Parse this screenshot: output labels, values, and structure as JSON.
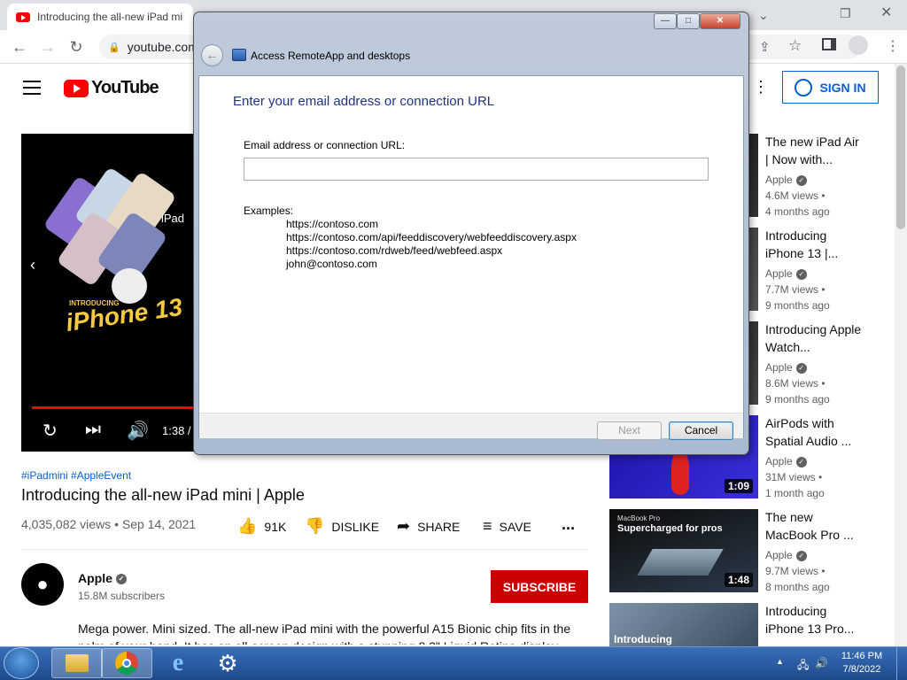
{
  "browser": {
    "tab_title": "Introducing the all-new iPad mi",
    "url": "youtube.com",
    "back": "←",
    "forward": "→",
    "reload": "↻",
    "lock": "🔒"
  },
  "youtube": {
    "logo": "YouTube",
    "sign_in": "SIGN IN",
    "video": {
      "thumb_text": "iPhone 13",
      "thumb_small": "INTRODUCING",
      "ipad_text": "iPad",
      "time": "1:38 /",
      "tags": "#iPadmini #AppleEvent",
      "title": "Introducing the all-new iPad mini | Apple",
      "views": "4,035,082 views • Sep 14, 2021",
      "likes": "91K",
      "dislike": "DISLIKE",
      "share": "SHARE",
      "save": "SAVE",
      "more": "..."
    },
    "channel": {
      "name": "Apple",
      "subscribers": "15.8M subscribers",
      "subscribe": "SUBSCRIBE",
      "description": "Mega power. Mini sized. The all-new iPad mini with the powerful A15 Bionic chip fits in the palm of your hand. It has an all-screen design with a stunning 8.3\" Liquid Retina display"
    },
    "sidebar": [
      {
        "title": "The new iPad Air | Now with...",
        "channel": "Apple",
        "views": "4.6M views •",
        "age": "4 months ago",
        "duration": "",
        "overlay": ""
      },
      {
        "title": "Introducing iPhone 13 |...",
        "channel": "Apple",
        "views": "7.7M views •",
        "age": "9 months ago",
        "duration": "",
        "overlay": ""
      },
      {
        "title": "Introducing Apple Watch...",
        "channel": "Apple",
        "views": "8.6M views •",
        "age": "9 months ago",
        "duration": "",
        "overlay": ""
      },
      {
        "title": "AirPods with Spatial Audio ...",
        "channel": "Apple",
        "views": "31M views •",
        "age": "1 month ago",
        "duration": "1:09",
        "overlay": ""
      },
      {
        "title": "The new MacBook Pro ...",
        "channel": "Apple",
        "views": "9.7M views •",
        "age": "8 months ago",
        "duration": "1:48",
        "overlay": "Supercharged for pros",
        "overlay_small": "MacBook Pro"
      },
      {
        "title": "Introducing iPhone 13 Pro...",
        "channel": "",
        "views": "",
        "age": "",
        "duration": "",
        "overlay": "Introducing"
      }
    ]
  },
  "dialog": {
    "title": "Access RemoteApp and desktops",
    "heading": "Enter your email address or connection URL",
    "field_label": "Email address or connection URL:",
    "input_value": "",
    "examples_label": "Examples:",
    "examples": [
      "https://contoso.com",
      "https://contoso.com/api/feeddiscovery/webfeeddiscovery.aspx",
      "https://contoso.com/rdweb/feed/webfeed.aspx",
      "john@contoso.com"
    ],
    "next": "Next",
    "cancel": "Cancel",
    "minimize": "—",
    "maximize": "□",
    "close": "✕"
  },
  "taskbar": {
    "time": "11:46 PM",
    "date": "7/8/2022"
  },
  "colors": {
    "youtube_red": "#ff0000",
    "subscribe_red": "#cc0000",
    "link_blue": "#065fd4",
    "dialog_heading": "#1e3287"
  }
}
